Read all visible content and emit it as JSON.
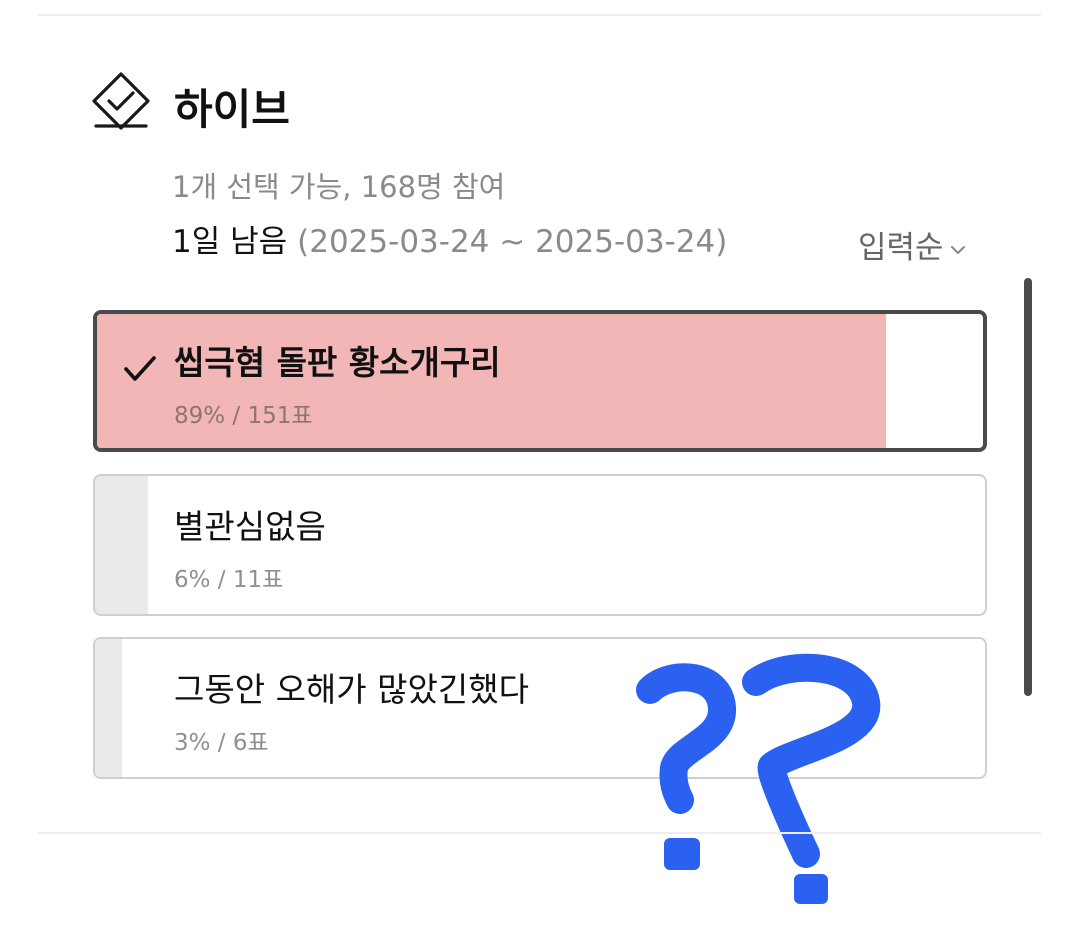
{
  "poll": {
    "icon": "vote-check-diamond-icon",
    "title": "하이브",
    "meta": "1개 선택 가능, 168명 참여",
    "deadline_remaining": "1일 남음",
    "deadline_range": "(2025-03-24 ~ 2025-03-24)",
    "sort_label": "입력순",
    "sort_icon": "chevron-down-icon"
  },
  "options": [
    {
      "label": "씹극혐 돌판 황소개구리",
      "stats": "89% / 151표",
      "percent": 89,
      "votes": 151,
      "selected": true,
      "fill_color": "#f2b6b6"
    },
    {
      "label": "별관심없음",
      "stats": "6% / 11표",
      "percent": 6,
      "votes": 11,
      "selected": false,
      "fill_color": "#e9eaec"
    },
    {
      "label": "그동안 오해가 많았긴했다",
      "stats": "3% / 6표",
      "percent": 3,
      "votes": 6,
      "selected": false,
      "fill_color": "#e9eaec"
    }
  ],
  "annotation": {
    "icon": "handwritten-question-marks",
    "color": "#2b61f0"
  }
}
